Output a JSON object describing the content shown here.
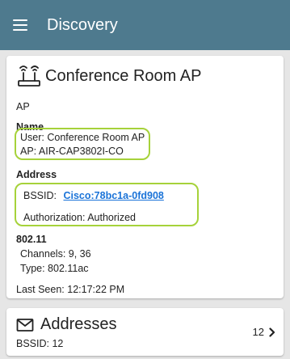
{
  "appbar": {
    "title": "Discovery"
  },
  "device": {
    "title": "Conference Room AP",
    "type": "AP",
    "name_heading": "Name",
    "user_line": "User:  Conference Room AP",
    "ap_line": "AP:  AIR-CAP3802I-CO",
    "address_heading": "Address",
    "bssid_label": "BSSID:",
    "bssid_value": "Cisco:78bc1a-0fd908",
    "authorization_line": "Authorization:  Authorized",
    "wifi_heading": "802.11",
    "channels_line": "Channels:  9, 36",
    "type_line": "Type:  802.11ac",
    "last_seen_line": "Last Seen:  12:17:22 PM"
  },
  "addresses": {
    "title": "Addresses",
    "subtitle": "BSSID:  12",
    "count": "12"
  },
  "colors": {
    "appbar": "#4e7a8e",
    "highlight": "#a6d23a",
    "link": "#1a73d8"
  },
  "icons": {
    "menu": "hamburger-menu-icon",
    "ap": "access-point-icon",
    "mail": "envelope-icon",
    "chevron": "chevron-right-icon"
  }
}
